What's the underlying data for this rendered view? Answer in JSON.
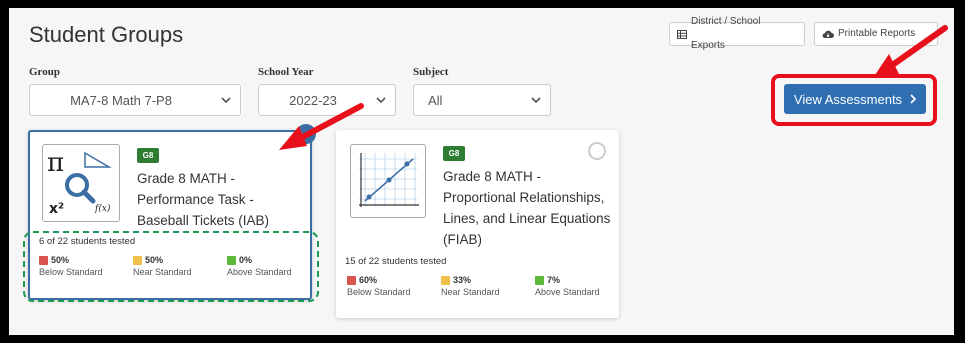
{
  "header": {
    "title": "Student Groups",
    "exports_label": "District / School Exports",
    "reports_label": "Printable Reports"
  },
  "filters": {
    "group": {
      "label": "Group",
      "value": "MA7-8 Math 7-P8"
    },
    "year": {
      "label": "School Year",
      "value": "2022-23"
    },
    "subject": {
      "label": "Subject",
      "value": "All"
    }
  },
  "view_button": {
    "label": "View Assessments"
  },
  "cards": [
    {
      "grade": "G8",
      "title": "Grade 8 MATH - Performance Task - Baseball Tickets (IAB)",
      "tested": "6 of 22 students tested",
      "selected": true,
      "stats": [
        {
          "pct": "50%",
          "label": "Below Standard"
        },
        {
          "pct": "50%",
          "label": "Near Standard"
        },
        {
          "pct": "0%",
          "label": "Above Standard"
        }
      ]
    },
    {
      "grade": "G8",
      "title": "Grade 8 MATH - Proportional Relationships, Lines, and Linear Equations (FIAB)",
      "tested": "15 of 22 students tested",
      "selected": false,
      "stats": [
        {
          "pct": "60%",
          "label": "Below Standard"
        },
        {
          "pct": "33%",
          "label": "Near Standard"
        },
        {
          "pct": "7%",
          "label": "Above Standard"
        }
      ]
    }
  ],
  "icon1_text": {
    "pi": "π",
    "x2": "x²",
    "fx": "f(x)"
  },
  "colors": {
    "below": "#d9534f",
    "near": "#f0c04a",
    "above": "#5cb837",
    "primary": "#2f6eb0",
    "annotation_red": "#e8101b",
    "annotation_green": "#1a9a50"
  }
}
